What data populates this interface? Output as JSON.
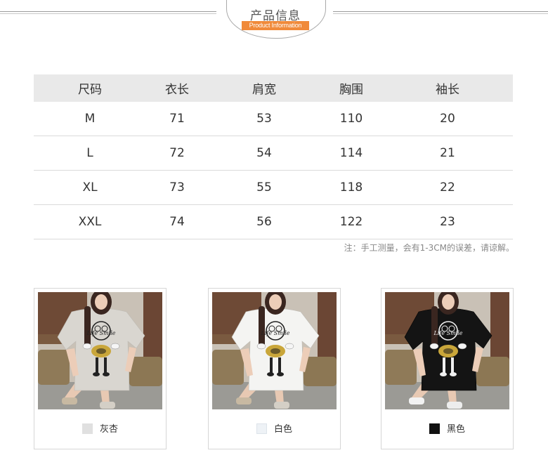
{
  "header": {
    "title": "产品信息",
    "subtitle": "Product Information"
  },
  "size_table": {
    "headers": [
      "尺码",
      "衣长",
      "肩宽",
      "胸围",
      "袖长"
    ],
    "rows": [
      [
        "M",
        "71",
        "53",
        "110",
        "20"
      ],
      [
        "L",
        "72",
        "54",
        "114",
        "21"
      ],
      [
        "XL",
        "73",
        "55",
        "118",
        "22"
      ],
      [
        "XXL",
        "74",
        "56",
        "122",
        "23"
      ]
    ]
  },
  "note": "注：手工测量，会有1-3CM的误差，请谅解。",
  "colors": [
    {
      "label": "灰杏",
      "swatch": "#e0e0e0",
      "shirt": "#d9d6d0"
    },
    {
      "label": "白色",
      "swatch": "#eef2f6",
      "shirt": "#f4f4f2"
    },
    {
      "label": "黑色",
      "swatch": "#111111",
      "shirt": "#141414"
    }
  ],
  "print_text": "Life Smile"
}
